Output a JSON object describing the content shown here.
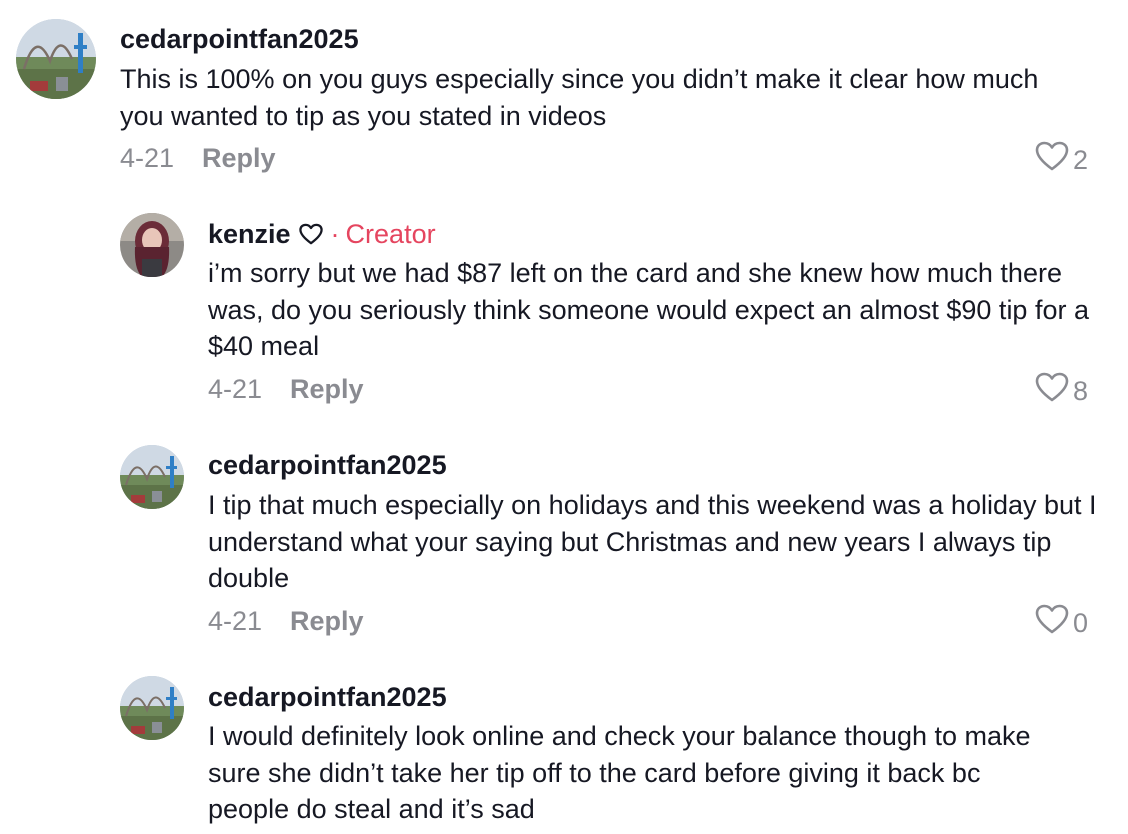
{
  "comments": [
    {
      "username": "cedarpointfan2025",
      "text": "This is 100% on you guys especially since you didn’t make it clear how much you wanted to tip as you stated in videos",
      "date": "4-21",
      "reply_label": "Reply",
      "likes": "2",
      "avatar": "roller-coaster-photo"
    },
    {
      "username": "kenzie",
      "username_icon": "heart-outline-icon",
      "separator": "·",
      "badge": "Creator",
      "text": "i’m sorry but we had $87 left on the card and she knew how much there was, do you seriously think someone would expect an almost $90 tip for a $40 meal",
      "date": "4-21",
      "reply_label": "Reply",
      "likes": "8",
      "avatar": "creator-portrait-photo"
    },
    {
      "username": "cedarpointfan2025",
      "text": "I tip that much especially on holidays and this weekend was a holiday but I understand what your saying but Christmas and new years I always tip double",
      "date": "4-21",
      "reply_label": "Reply",
      "likes": "0",
      "avatar": "roller-coaster-photo"
    },
    {
      "username": "cedarpointfan2025",
      "text": "I would definitely look online and check your balance though to make sure she didn’t take her tip off to the card before giving it back bc people do steal and it’s sad",
      "avatar": "roller-coaster-photo"
    }
  ],
  "colors": {
    "text": "#161823",
    "meta": "#8a8b91",
    "creator": "#e5455f"
  }
}
